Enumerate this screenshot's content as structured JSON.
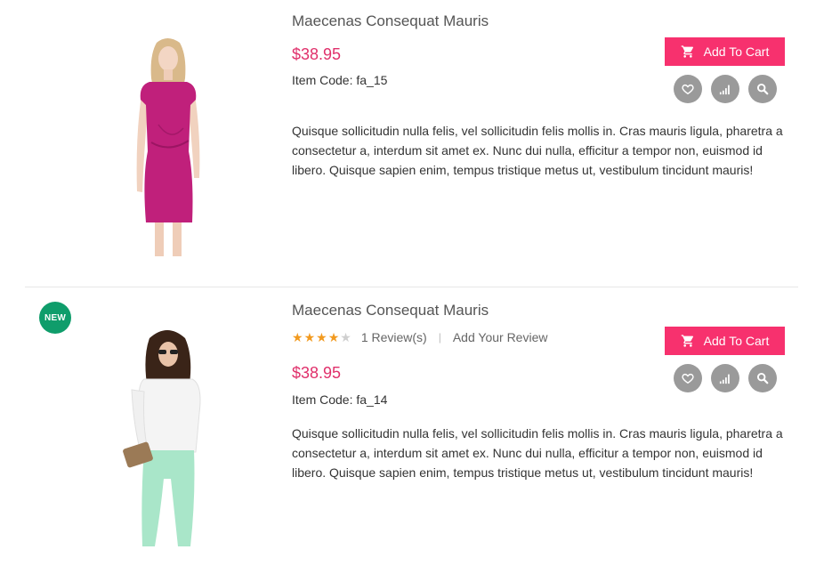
{
  "colors": {
    "price": "#e0306b",
    "cart_button": "#f7316e",
    "badge_new": "#0f9d6b",
    "action_circle": "#9a9a9a",
    "star_on": "#f29a1f",
    "star_off": "#cfcfcf"
  },
  "products": [
    {
      "title": "Maecenas Consequat Mauris",
      "price": "$38.95",
      "item_code": "Item Code: fa_15",
      "description": "Quisque sollicitudin nulla felis, vel sollicitudin felis mollis in. Cras mauris ligula, pharetra a consectetur a, interdum sit amet ex. Nunc dui nulla, efficitur a tempor non, euismod id libero. Quisque sapien enim, tempus tristique metus ut, vestibulum tincidunt mauris!",
      "add_to_cart": "Add To Cart",
      "icons": [
        "cart-icon",
        "heart-icon",
        "compare-icon",
        "search-icon"
      ]
    },
    {
      "badge": "NEW",
      "title": "Maecenas Consequat Mauris",
      "rating": 4,
      "rating_max": 5,
      "reviews": "1 Review(s)",
      "separator": "|",
      "add_review": "Add Your Review",
      "price": "$38.95",
      "item_code": "Item Code: fa_14",
      "description": "Quisque sollicitudin nulla felis, vel sollicitudin felis mollis in. Cras mauris ligula, pharetra a consectetur a, interdum sit amet ex. Nunc dui nulla, efficitur a tempor non, euismod id libero. Quisque sapien enim, tempus tristique metus ut, vestibulum tincidunt mauris!",
      "add_to_cart": "Add To Cart",
      "icons": [
        "cart-icon",
        "heart-icon",
        "compare-icon",
        "search-icon"
      ]
    }
  ]
}
